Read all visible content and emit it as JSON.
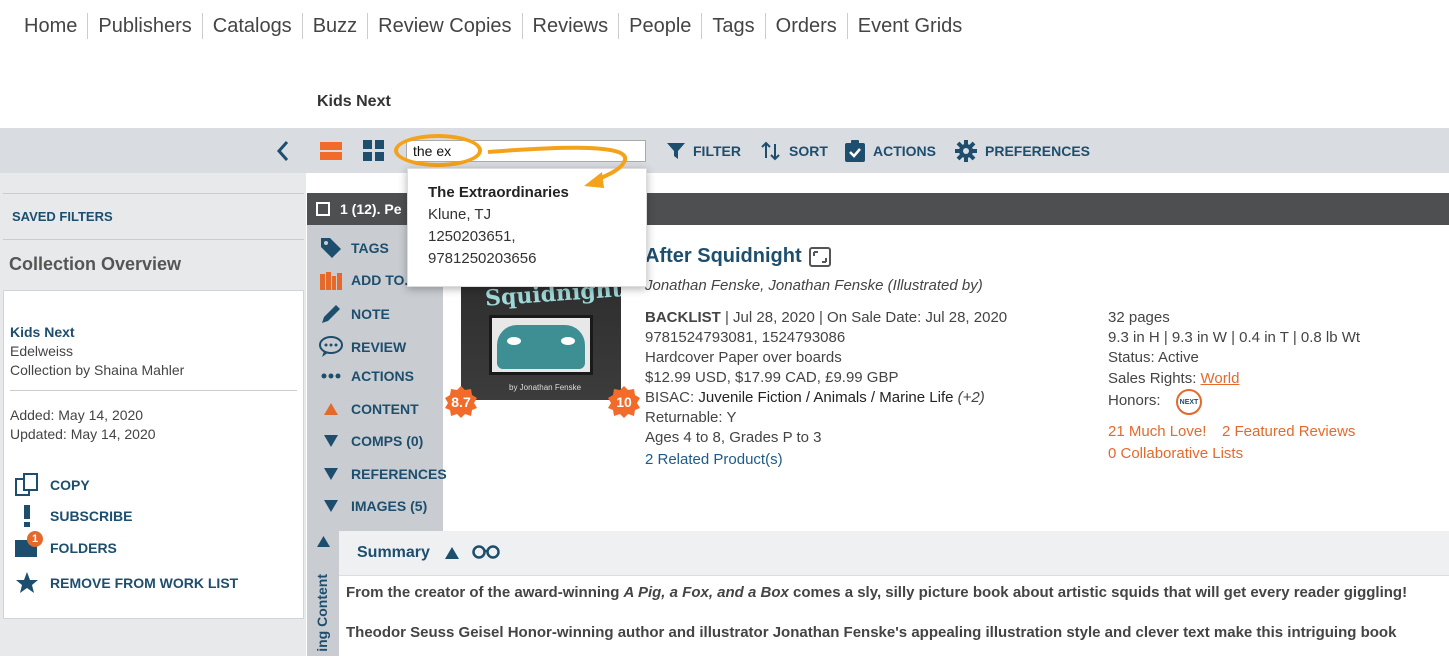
{
  "nav": {
    "items": [
      "Home",
      "Publishers",
      "Catalogs",
      "Buzz",
      "Review Copies",
      "Reviews",
      "People",
      "Tags",
      "Orders",
      "Event Grids"
    ]
  },
  "collection": {
    "name": "Kids Next"
  },
  "toolbar": {
    "search_value": "the ex",
    "filter_label": "FILTER",
    "sort_label": "SORT",
    "actions_label": "ACTIONS",
    "preferences_label": "PREFERENCES"
  },
  "dropdown": {
    "title": "The Extraordinaries",
    "author": "Klune, TJ",
    "isbn1": "1250203651,",
    "isbn2": "9781250203656"
  },
  "sidebar": {
    "saved_filters": "SAVED FILTERS",
    "overview_title": "Collection Overview",
    "card": {
      "name": "Kids Next",
      "org": "Edelweiss",
      "by": "Collection by Shaina Mahler",
      "added": "Added: May 14, 2020",
      "updated": "Updated: May 14, 2020"
    },
    "actions": {
      "copy": "COPY",
      "subscribe": "SUBSCRIBE",
      "folders": "FOLDERS",
      "folders_count": "1",
      "remove": "REMOVE FROM WORK LIST"
    }
  },
  "list_header": {
    "text": "1 (12). Pe"
  },
  "item_menu": {
    "tags": "TAGS",
    "add_to": "ADD TO...",
    "note": "NOTE",
    "review": "REVIEW",
    "actions": "ACTIONS",
    "content": "CONTENT",
    "comps": "COMPS (0)",
    "references": "REFERENCES",
    "images": "IMAGES (5)",
    "vertical_label": "ing Content"
  },
  "book": {
    "cover_text": "Squidnight",
    "cover_author": "by Jonathan Fenske",
    "badge_left": "8.7",
    "badge_right": "10",
    "title": "After Squidnight",
    "contributors": "Jonathan Fenske, Jonathan Fenske (Illustrated by)",
    "status_label": "BACKLIST",
    "dates": " | Jul 28, 2020 | On Sale Date: Jul 28, 2020",
    "isbns": "9781524793081, 1524793086",
    "format": "Hardcover Paper over boards",
    "prices": "$12.99 USD, $17.99 CAD, £9.99 GBP",
    "bisac_prefix": "BISAC: ",
    "bisac": "Juvenile Fiction / Animals / Marine Life",
    "bisac_more": " (+2)",
    "returnable": "Returnable: Y",
    "ages": "Ages 4 to 8, Grades P to 3",
    "related": "2 Related Product(s)",
    "pages": "32 pages",
    "dimensions": "9.3 in H | 9.3 in W | 0.4 in T | 0.8 lb Wt",
    "status": "Status: Active",
    "sales_rights_label": "Sales Rights: ",
    "sales_rights": "World",
    "honors_label": "Honors:",
    "honors_badge": "NEXT",
    "much_love": "21 Much Love!",
    "featured": "2 Featured Reviews",
    "collab": "0 Collaborative Lists"
  },
  "summary": {
    "label": "Summary",
    "line1_a": "From the creator of the award-winning ",
    "line1_b": "A Pig, a Fox, and a Box",
    "line1_c": " comes a sly, silly picture book about artistic squids that will get every reader giggling!",
    "line2": "Theodor Seuss Geisel Honor-winning author and illustrator Jonathan Fenske's appealing illustration style and clever text make this intriguing book"
  },
  "colors": {
    "accent_blue": "#1d4e6e",
    "orange": "#e46a2c",
    "highlight": "#f5a21b"
  }
}
